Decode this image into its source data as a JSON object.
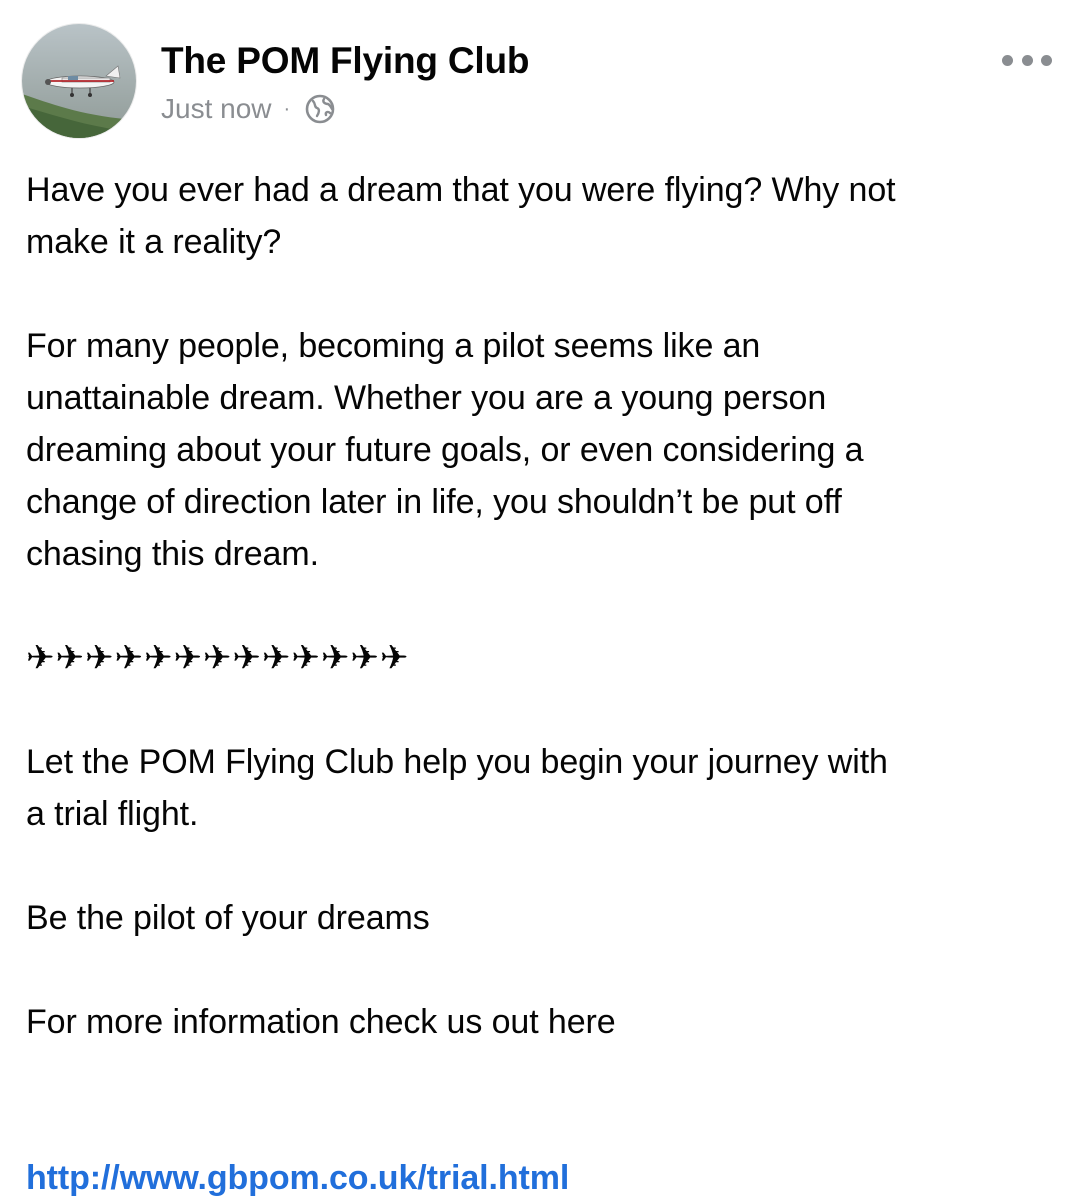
{
  "post": {
    "author": "The POM Flying Club",
    "timestamp": "Just now",
    "separator": "·",
    "privacy_icon": "globe-icon",
    "more_icon": "more-options-icon",
    "avatar_image": "aircraft-photo",
    "paragraphs": {
      "p1": "Have you ever had a dream that you were flying? Why not\nmake it a reality?",
      "p2": "For many people, becoming a pilot seems like an\nunattainable dream. Whether you are a young person\ndreaming about your future goals, or even considering a\nchange of direction later in life, you shouldn’t be put off\nchasing this dream.",
      "planes": "✈✈✈✈✈✈✈✈✈✈✈✈✈",
      "p3": "Let the POM Flying Club help you begin your journey with\na trial flight.",
      "p4": "Be the pilot of your dreams",
      "p5": "For more information check us out here"
    },
    "link": "http://www.gbpom.co.uk/trial.html"
  },
  "colors": {
    "text": "#050505",
    "meta": "#8a8d91",
    "link": "#216fdb"
  }
}
